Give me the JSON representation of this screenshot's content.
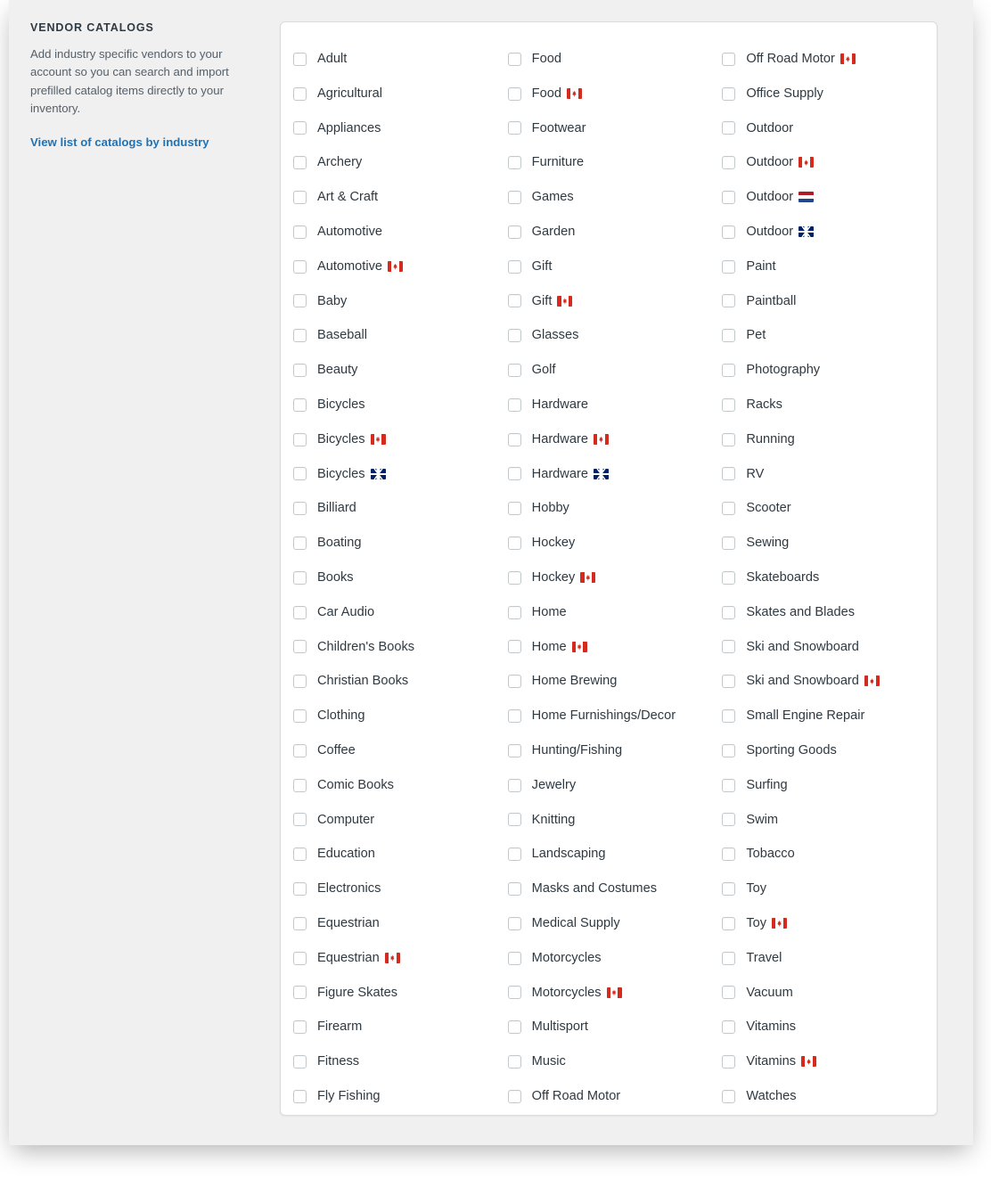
{
  "sidebar": {
    "title": "VENDOR CATALOGS",
    "description": "Add industry specific vendors to your account so you can search and import prefilled catalog items directly to your inventory.",
    "link_label": "View list of catalogs by industry",
    "link_color": "#1f73b7"
  },
  "catalog_panel": {
    "columns": [
      {
        "items": [
          {
            "label": "Adult",
            "flag": null,
            "checked": false
          },
          {
            "label": "Agricultural",
            "flag": null,
            "checked": false
          },
          {
            "label": "Appliances",
            "flag": null,
            "checked": false
          },
          {
            "label": "Archery",
            "flag": null,
            "checked": false
          },
          {
            "label": "Art & Craft",
            "flag": null,
            "checked": false
          },
          {
            "label": "Automotive",
            "flag": null,
            "checked": false
          },
          {
            "label": "Automotive",
            "flag": "ca",
            "checked": false
          },
          {
            "label": "Baby",
            "flag": null,
            "checked": false
          },
          {
            "label": "Baseball",
            "flag": null,
            "checked": false
          },
          {
            "label": "Beauty",
            "flag": null,
            "checked": false
          },
          {
            "label": "Bicycles",
            "flag": null,
            "checked": false
          },
          {
            "label": "Bicycles",
            "flag": "ca",
            "checked": false
          },
          {
            "label": "Bicycles",
            "flag": "gb",
            "checked": false
          },
          {
            "label": "Billiard",
            "flag": null,
            "checked": false
          },
          {
            "label": "Boating",
            "flag": null,
            "checked": false
          },
          {
            "label": "Books",
            "flag": null,
            "checked": false
          },
          {
            "label": "Car Audio",
            "flag": null,
            "checked": false
          },
          {
            "label": "Children's Books",
            "flag": null,
            "checked": false
          },
          {
            "label": "Christian Books",
            "flag": null,
            "checked": false
          },
          {
            "label": "Clothing",
            "flag": null,
            "checked": false
          },
          {
            "label": "Coffee",
            "flag": null,
            "checked": false
          },
          {
            "label": "Comic Books",
            "flag": null,
            "checked": false
          },
          {
            "label": "Computer",
            "flag": null,
            "checked": false
          },
          {
            "label": "Education",
            "flag": null,
            "checked": false
          },
          {
            "label": "Electronics",
            "flag": null,
            "checked": false
          },
          {
            "label": "Equestrian",
            "flag": null,
            "checked": false
          },
          {
            "label": "Equestrian",
            "flag": "ca",
            "checked": false
          },
          {
            "label": "Figure Skates",
            "flag": null,
            "checked": false
          },
          {
            "label": "Firearm",
            "flag": null,
            "checked": false
          },
          {
            "label": "Fitness",
            "flag": null,
            "checked": false
          },
          {
            "label": "Fly Fishing",
            "flag": null,
            "checked": false
          }
        ]
      },
      {
        "items": [
          {
            "label": "Food",
            "flag": null,
            "checked": false
          },
          {
            "label": "Food",
            "flag": "ca",
            "checked": false
          },
          {
            "label": "Footwear",
            "flag": null,
            "checked": false
          },
          {
            "label": "Furniture",
            "flag": null,
            "checked": false
          },
          {
            "label": "Games",
            "flag": null,
            "checked": false
          },
          {
            "label": "Garden",
            "flag": null,
            "checked": false
          },
          {
            "label": "Gift",
            "flag": null,
            "checked": false
          },
          {
            "label": "Gift",
            "flag": "ca",
            "checked": false
          },
          {
            "label": "Glasses",
            "flag": null,
            "checked": false
          },
          {
            "label": "Golf",
            "flag": null,
            "checked": false
          },
          {
            "label": "Hardware",
            "flag": null,
            "checked": false
          },
          {
            "label": "Hardware",
            "flag": "ca",
            "checked": false
          },
          {
            "label": "Hardware",
            "flag": "gb",
            "checked": false
          },
          {
            "label": "Hobby",
            "flag": null,
            "checked": false
          },
          {
            "label": "Hockey",
            "flag": null,
            "checked": false
          },
          {
            "label": "Hockey",
            "flag": "ca",
            "checked": false
          },
          {
            "label": "Home",
            "flag": null,
            "checked": false
          },
          {
            "label": "Home",
            "flag": "ca",
            "checked": false
          },
          {
            "label": "Home Brewing",
            "flag": null,
            "checked": false
          },
          {
            "label": "Home Furnishings/Decor",
            "flag": null,
            "checked": false
          },
          {
            "label": "Hunting/Fishing",
            "flag": null,
            "checked": false
          },
          {
            "label": "Jewelry",
            "flag": null,
            "checked": false
          },
          {
            "label": "Knitting",
            "flag": null,
            "checked": false
          },
          {
            "label": "Landscaping",
            "flag": null,
            "checked": false
          },
          {
            "label": "Masks and Costumes",
            "flag": null,
            "checked": false
          },
          {
            "label": "Medical Supply",
            "flag": null,
            "checked": false
          },
          {
            "label": "Motorcycles",
            "flag": null,
            "checked": false
          },
          {
            "label": "Motorcycles",
            "flag": "ca",
            "checked": false
          },
          {
            "label": "Multisport",
            "flag": null,
            "checked": false
          },
          {
            "label": "Music",
            "flag": null,
            "checked": false
          },
          {
            "label": "Off Road Motor",
            "flag": null,
            "checked": false
          }
        ]
      },
      {
        "items": [
          {
            "label": "Off Road Motor",
            "flag": "ca",
            "checked": false
          },
          {
            "label": "Office Supply",
            "flag": null,
            "checked": false
          },
          {
            "label": "Outdoor",
            "flag": null,
            "checked": false
          },
          {
            "label": "Outdoor",
            "flag": "ca",
            "checked": false
          },
          {
            "label": "Outdoor",
            "flag": "nl",
            "checked": false
          },
          {
            "label": "Outdoor",
            "flag": "gb",
            "checked": false
          },
          {
            "label": "Paint",
            "flag": null,
            "checked": false
          },
          {
            "label": "Paintball",
            "flag": null,
            "checked": false
          },
          {
            "label": "Pet",
            "flag": null,
            "checked": false
          },
          {
            "label": "Photography",
            "flag": null,
            "checked": false
          },
          {
            "label": "Racks",
            "flag": null,
            "checked": false
          },
          {
            "label": "Running",
            "flag": null,
            "checked": false
          },
          {
            "label": "RV",
            "flag": null,
            "checked": false
          },
          {
            "label": "Scooter",
            "flag": null,
            "checked": false
          },
          {
            "label": "Sewing",
            "flag": null,
            "checked": false
          },
          {
            "label": "Skateboards",
            "flag": null,
            "checked": false
          },
          {
            "label": "Skates and Blades",
            "flag": null,
            "checked": false
          },
          {
            "label": "Ski and Snowboard",
            "flag": null,
            "checked": false
          },
          {
            "label": "Ski and Snowboard",
            "flag": "ca",
            "checked": false
          },
          {
            "label": "Small Engine Repair",
            "flag": null,
            "checked": false
          },
          {
            "label": "Sporting Goods",
            "flag": null,
            "checked": false
          },
          {
            "label": "Surfing",
            "flag": null,
            "checked": false
          },
          {
            "label": "Swim",
            "flag": null,
            "checked": false
          },
          {
            "label": "Tobacco",
            "flag": null,
            "checked": false
          },
          {
            "label": "Toy",
            "flag": null,
            "checked": false
          },
          {
            "label": "Toy",
            "flag": "ca",
            "checked": false
          },
          {
            "label": "Travel",
            "flag": null,
            "checked": false
          },
          {
            "label": "Vacuum",
            "flag": null,
            "checked": false
          },
          {
            "label": "Vitamins",
            "flag": null,
            "checked": false
          },
          {
            "label": "Vitamins",
            "flag": "ca",
            "checked": false
          },
          {
            "label": "Watches",
            "flag": null,
            "checked": false
          }
        ]
      }
    ]
  }
}
